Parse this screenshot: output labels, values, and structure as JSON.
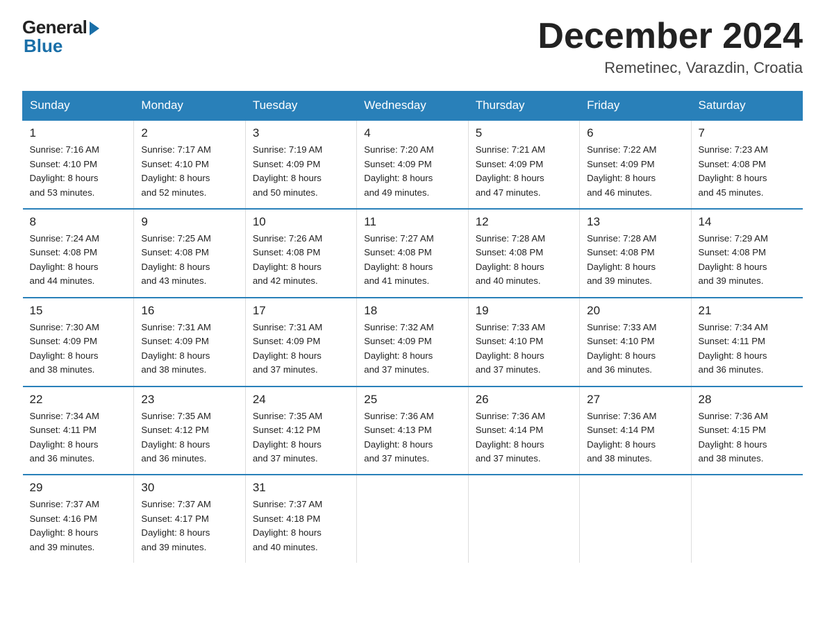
{
  "logo": {
    "general": "General",
    "blue": "Blue"
  },
  "title": "December 2024",
  "location": "Remetinec, Varazdin, Croatia",
  "days_of_week": [
    "Sunday",
    "Monday",
    "Tuesday",
    "Wednesday",
    "Thursday",
    "Friday",
    "Saturday"
  ],
  "weeks": [
    [
      {
        "day": "1",
        "sunrise": "7:16 AM",
        "sunset": "4:10 PM",
        "daylight": "8 hours and 53 minutes."
      },
      {
        "day": "2",
        "sunrise": "7:17 AM",
        "sunset": "4:10 PM",
        "daylight": "8 hours and 52 minutes."
      },
      {
        "day": "3",
        "sunrise": "7:19 AM",
        "sunset": "4:09 PM",
        "daylight": "8 hours and 50 minutes."
      },
      {
        "day": "4",
        "sunrise": "7:20 AM",
        "sunset": "4:09 PM",
        "daylight": "8 hours and 49 minutes."
      },
      {
        "day": "5",
        "sunrise": "7:21 AM",
        "sunset": "4:09 PM",
        "daylight": "8 hours and 47 minutes."
      },
      {
        "day": "6",
        "sunrise": "7:22 AM",
        "sunset": "4:09 PM",
        "daylight": "8 hours and 46 minutes."
      },
      {
        "day": "7",
        "sunrise": "7:23 AM",
        "sunset": "4:08 PM",
        "daylight": "8 hours and 45 minutes."
      }
    ],
    [
      {
        "day": "8",
        "sunrise": "7:24 AM",
        "sunset": "4:08 PM",
        "daylight": "8 hours and 44 minutes."
      },
      {
        "day": "9",
        "sunrise": "7:25 AM",
        "sunset": "4:08 PM",
        "daylight": "8 hours and 43 minutes."
      },
      {
        "day": "10",
        "sunrise": "7:26 AM",
        "sunset": "4:08 PM",
        "daylight": "8 hours and 42 minutes."
      },
      {
        "day": "11",
        "sunrise": "7:27 AM",
        "sunset": "4:08 PM",
        "daylight": "8 hours and 41 minutes."
      },
      {
        "day": "12",
        "sunrise": "7:28 AM",
        "sunset": "4:08 PM",
        "daylight": "8 hours and 40 minutes."
      },
      {
        "day": "13",
        "sunrise": "7:28 AM",
        "sunset": "4:08 PM",
        "daylight": "8 hours and 39 minutes."
      },
      {
        "day": "14",
        "sunrise": "7:29 AM",
        "sunset": "4:08 PM",
        "daylight": "8 hours and 39 minutes."
      }
    ],
    [
      {
        "day": "15",
        "sunrise": "7:30 AM",
        "sunset": "4:09 PM",
        "daylight": "8 hours and 38 minutes."
      },
      {
        "day": "16",
        "sunrise": "7:31 AM",
        "sunset": "4:09 PM",
        "daylight": "8 hours and 38 minutes."
      },
      {
        "day": "17",
        "sunrise": "7:31 AM",
        "sunset": "4:09 PM",
        "daylight": "8 hours and 37 minutes."
      },
      {
        "day": "18",
        "sunrise": "7:32 AM",
        "sunset": "4:09 PM",
        "daylight": "8 hours and 37 minutes."
      },
      {
        "day": "19",
        "sunrise": "7:33 AM",
        "sunset": "4:10 PM",
        "daylight": "8 hours and 37 minutes."
      },
      {
        "day": "20",
        "sunrise": "7:33 AM",
        "sunset": "4:10 PM",
        "daylight": "8 hours and 36 minutes."
      },
      {
        "day": "21",
        "sunrise": "7:34 AM",
        "sunset": "4:11 PM",
        "daylight": "8 hours and 36 minutes."
      }
    ],
    [
      {
        "day": "22",
        "sunrise": "7:34 AM",
        "sunset": "4:11 PM",
        "daylight": "8 hours and 36 minutes."
      },
      {
        "day": "23",
        "sunrise": "7:35 AM",
        "sunset": "4:12 PM",
        "daylight": "8 hours and 36 minutes."
      },
      {
        "day": "24",
        "sunrise": "7:35 AM",
        "sunset": "4:12 PM",
        "daylight": "8 hours and 37 minutes."
      },
      {
        "day": "25",
        "sunrise": "7:36 AM",
        "sunset": "4:13 PM",
        "daylight": "8 hours and 37 minutes."
      },
      {
        "day": "26",
        "sunrise": "7:36 AM",
        "sunset": "4:14 PM",
        "daylight": "8 hours and 37 minutes."
      },
      {
        "day": "27",
        "sunrise": "7:36 AM",
        "sunset": "4:14 PM",
        "daylight": "8 hours and 38 minutes."
      },
      {
        "day": "28",
        "sunrise": "7:36 AM",
        "sunset": "4:15 PM",
        "daylight": "8 hours and 38 minutes."
      }
    ],
    [
      {
        "day": "29",
        "sunrise": "7:37 AM",
        "sunset": "4:16 PM",
        "daylight": "8 hours and 39 minutes."
      },
      {
        "day": "30",
        "sunrise": "7:37 AM",
        "sunset": "4:17 PM",
        "daylight": "8 hours and 39 minutes."
      },
      {
        "day": "31",
        "sunrise": "7:37 AM",
        "sunset": "4:18 PM",
        "daylight": "8 hours and 40 minutes."
      },
      {
        "day": "",
        "sunrise": "",
        "sunset": "",
        "daylight": ""
      },
      {
        "day": "",
        "sunrise": "",
        "sunset": "",
        "daylight": ""
      },
      {
        "day": "",
        "sunrise": "",
        "sunset": "",
        "daylight": ""
      },
      {
        "day": "",
        "sunrise": "",
        "sunset": "",
        "daylight": ""
      }
    ]
  ],
  "labels": {
    "sunrise": "Sunrise:",
    "sunset": "Sunset:",
    "daylight": "Daylight:"
  }
}
